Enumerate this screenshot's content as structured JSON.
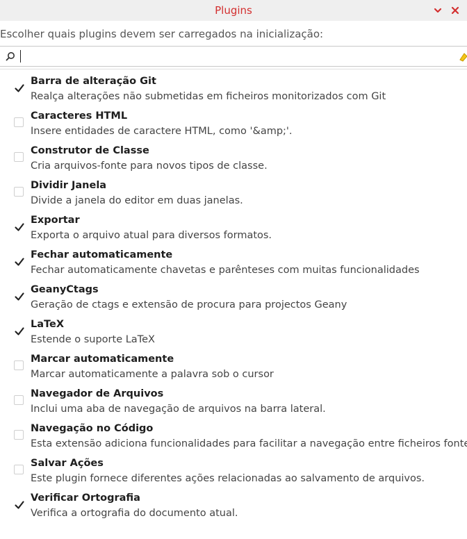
{
  "window": {
    "title": "Plugins",
    "icons": {
      "minimize": "chevron-down-icon",
      "close": "close-icon"
    },
    "accent": "#d32f2f"
  },
  "header": {
    "subtitle": "Escolher quais plugins devem ser carregados na inicialização:"
  },
  "search": {
    "value": "",
    "icons": {
      "search": "search-icon",
      "clear": "clear-icon"
    }
  },
  "plugins": [
    {
      "name": "Barra de alteração Git",
      "description": "Realça alterações não submetidas em ficheiros monitorizados com Git",
      "enabled": true
    },
    {
      "name": "Caracteres HTML",
      "description": "Insere entidades de caractere HTML, como '&amp;'.",
      "enabled": false
    },
    {
      "name": "Construtor de Classe",
      "description": "Cria arquivos-fonte para novos tipos de classe.",
      "enabled": false
    },
    {
      "name": "Dividir Janela",
      "description": "Divide a janela do editor em duas janelas.",
      "enabled": false
    },
    {
      "name": "Exportar",
      "description": "Exporta o arquivo atual para diversos formatos.",
      "enabled": true
    },
    {
      "name": "Fechar automaticamente",
      "description": "Fechar automaticamente chavetas e parênteses com muitas funcionalidades",
      "enabled": true
    },
    {
      "name": "GeanyCtags",
      "description": "Geração de ctags e extensão de procura para projectos Geany",
      "enabled": true
    },
    {
      "name": "LaTeX",
      "description": "Estende o suporte LaTeX",
      "enabled": true
    },
    {
      "name": "Marcar automaticamente",
      "description": "Marcar automaticamente a palavra sob o cursor",
      "enabled": false
    },
    {
      "name": "Navegador de Arquivos",
      "description": "Inclui uma aba de navegação de arquivos na barra lateral.",
      "enabled": false
    },
    {
      "name": "Navegação no Código",
      "description": "Esta extensão adiciona funcionalidades para facilitar a navegação entre ficheiros fonte.",
      "enabled": false
    },
    {
      "name": "Salvar Ações",
      "description": "Este plugin fornece diferentes ações relacionadas ao salvamento de arquivos.",
      "enabled": false
    },
    {
      "name": "Verificar Ortografia",
      "description": "Verifica a ortografia do documento atual.",
      "enabled": true
    }
  ]
}
